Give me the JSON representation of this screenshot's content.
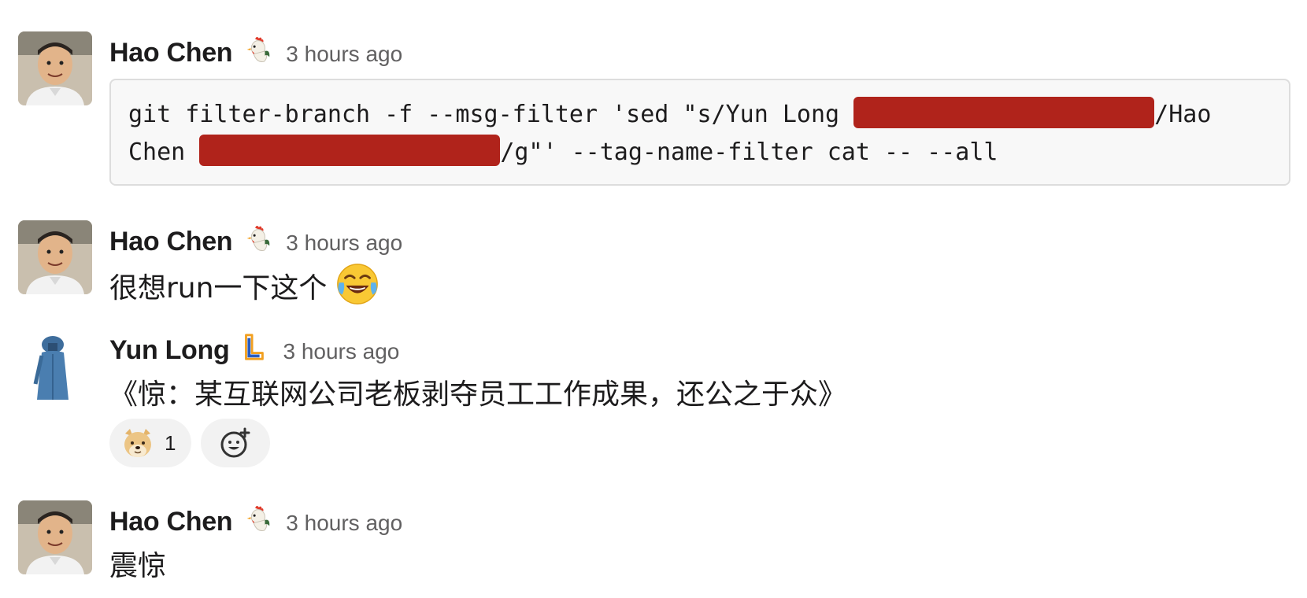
{
  "messages": [
    {
      "sender": "Hao Chen",
      "status_emoji": "rooster-icon",
      "timestamp": "3 hours ago",
      "code": {
        "line1_prefix": "git filter-branch -f --msg-filter 'sed \"s/Yun Long ",
        "line1_suffix": "/Hao",
        "line2_prefix": "Chen ",
        "line2_suffix": "/g\"' --tag-name-filter cat -- --all"
      }
    },
    {
      "sender": "Hao Chen",
      "status_emoji": "rooster-icon",
      "timestamp": "3 hours ago",
      "text": "很想run一下这个",
      "inline_emoji": "tears-of-joy-icon"
    },
    {
      "sender": "Yun Long",
      "status_emoji": "letter-l-icon",
      "timestamp": "3 hours ago",
      "text": "《惊：某互联网公司老板剥夺员工工作成果，还公之于众》",
      "reactions": [
        {
          "emoji": "doge-icon",
          "count": "1"
        }
      ]
    },
    {
      "sender": "Hao Chen",
      "status_emoji": "rooster-icon",
      "timestamp": "3 hours ago",
      "text": "震惊"
    }
  ],
  "colors": {
    "redaction": "#b0231b",
    "timestamp": "#616061",
    "code_background": "#f8f8f8",
    "reaction_background": "#f2f2f2"
  }
}
